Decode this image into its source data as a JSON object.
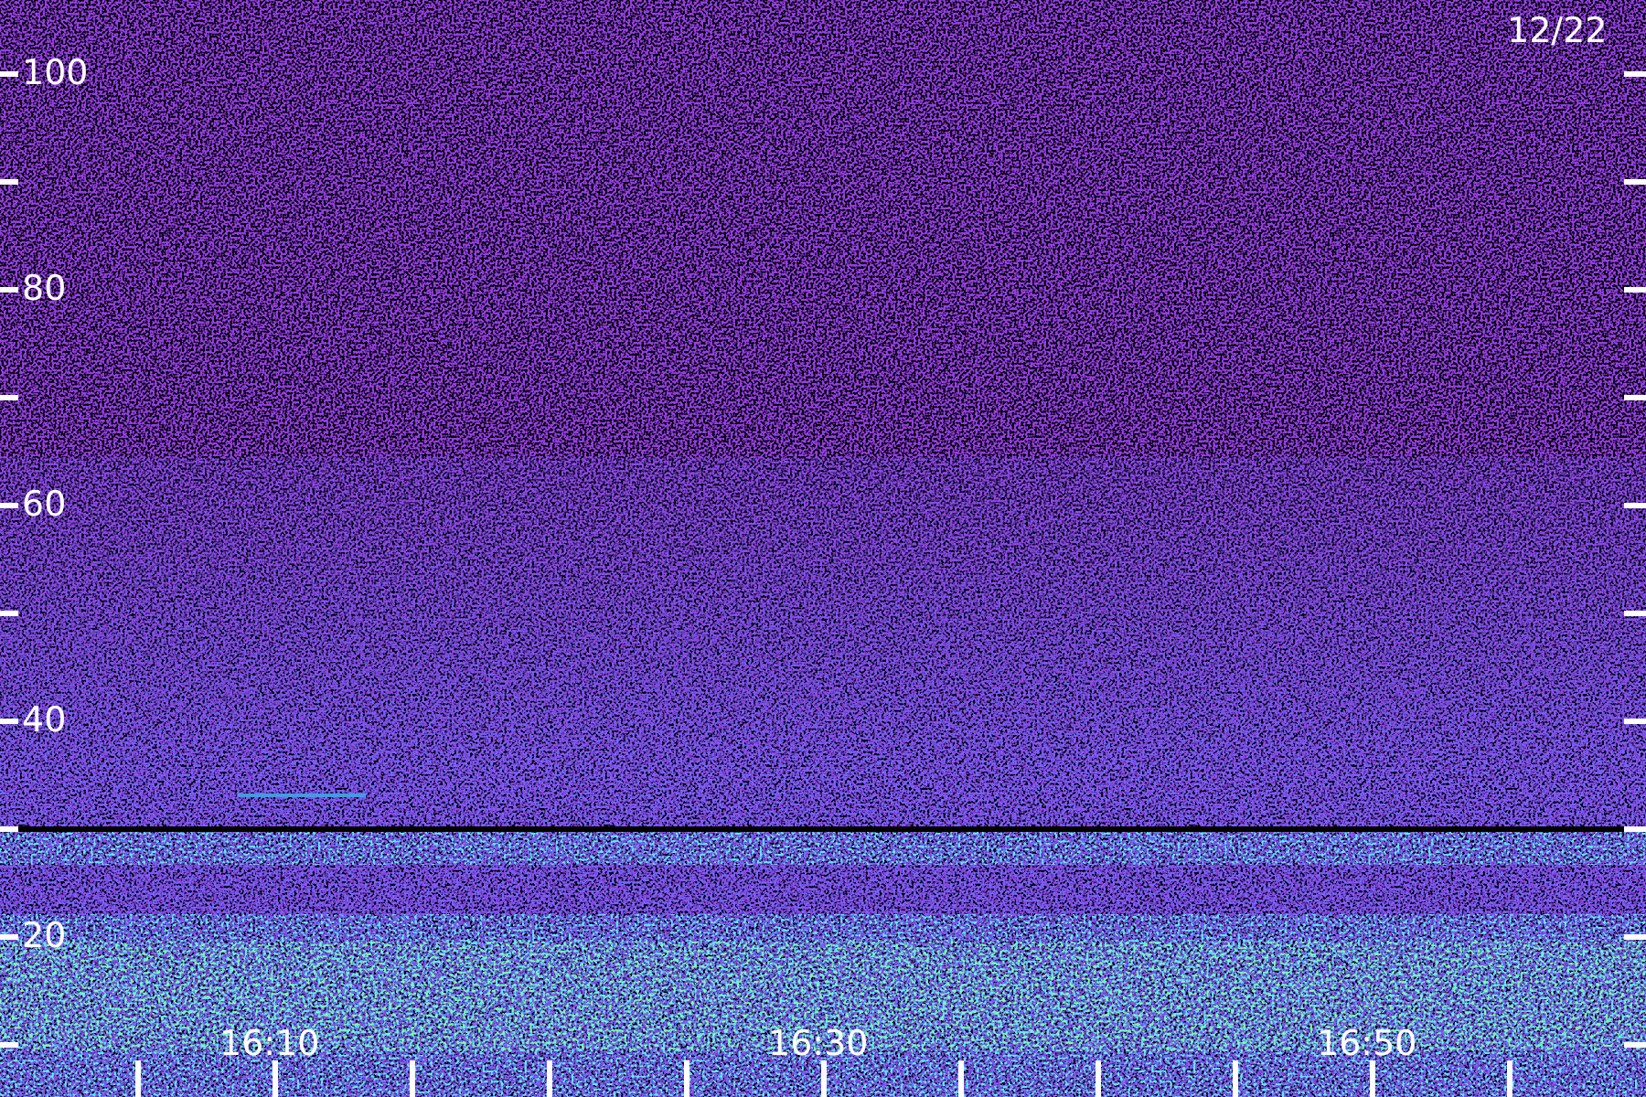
{
  "date_label": "12/22",
  "y_axis": {
    "labels": [
      "100",
      "80",
      "60",
      "40",
      "20"
    ]
  },
  "x_axis": {
    "labels": [
      "16:10",
      "16:30",
      "16:50"
    ]
  }
}
